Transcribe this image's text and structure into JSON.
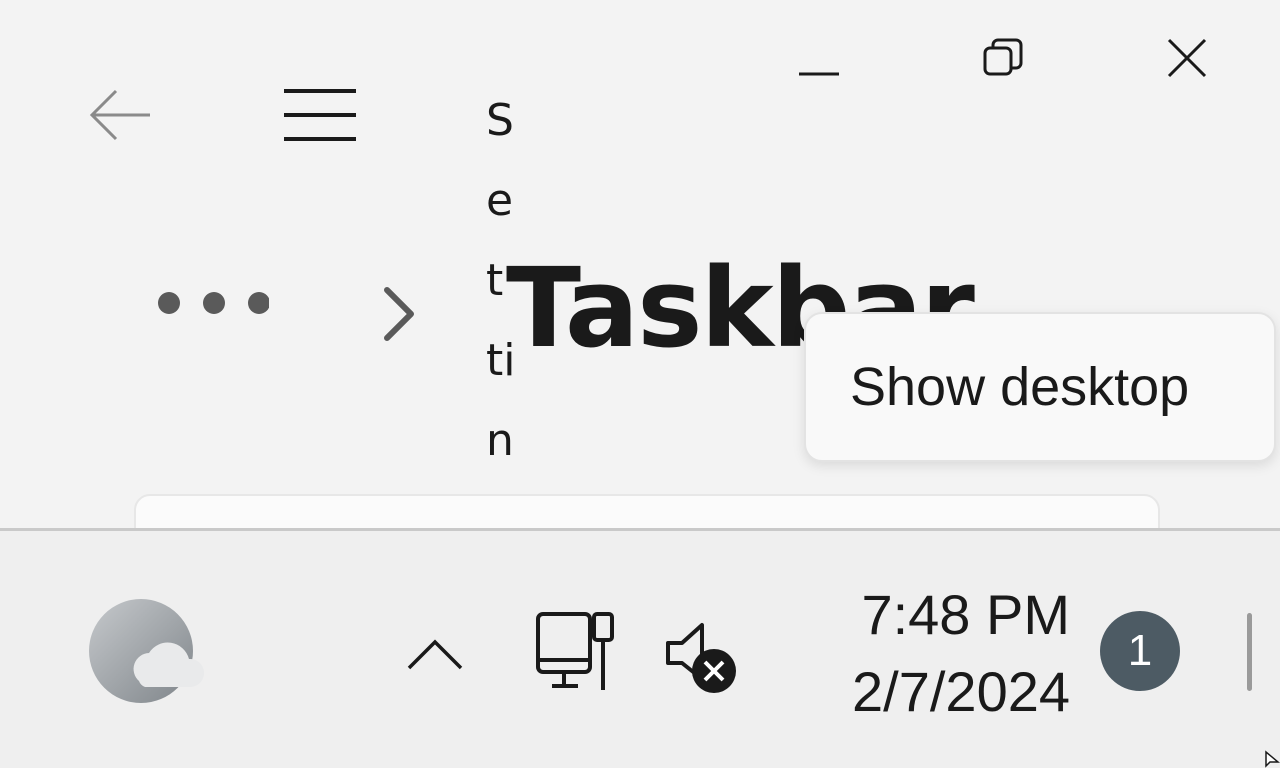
{
  "window": {
    "app_title": "Settings",
    "app_title_chars": [
      "S",
      "e",
      "t",
      "ti",
      "n"
    ],
    "page_title": "Taskbar",
    "caption": {
      "minimize_icon": "minimize-icon",
      "restore_icon": "restore-icon",
      "close_icon": "close-icon"
    },
    "nav": {
      "back_icon": "back-arrow-icon",
      "menu_icon": "hamburger-menu-icon",
      "more_icon": "more-ellipsis-icon",
      "chevron_icon": "chevron-right-icon"
    }
  },
  "tooltip": {
    "text": "Show desktop"
  },
  "taskbar": {
    "weather_icon": "weather-cloud-icon",
    "overflow_icon": "chevron-up-icon",
    "network_icon": "wired-network-icon",
    "volume_icon": "volume-muted-icon",
    "clock": {
      "time": "7:48 PM",
      "date": "2/7/2024"
    },
    "notification_count": "1",
    "colors": {
      "badge": "#4d5b64",
      "mute_badge": "#1a1a1a"
    }
  }
}
